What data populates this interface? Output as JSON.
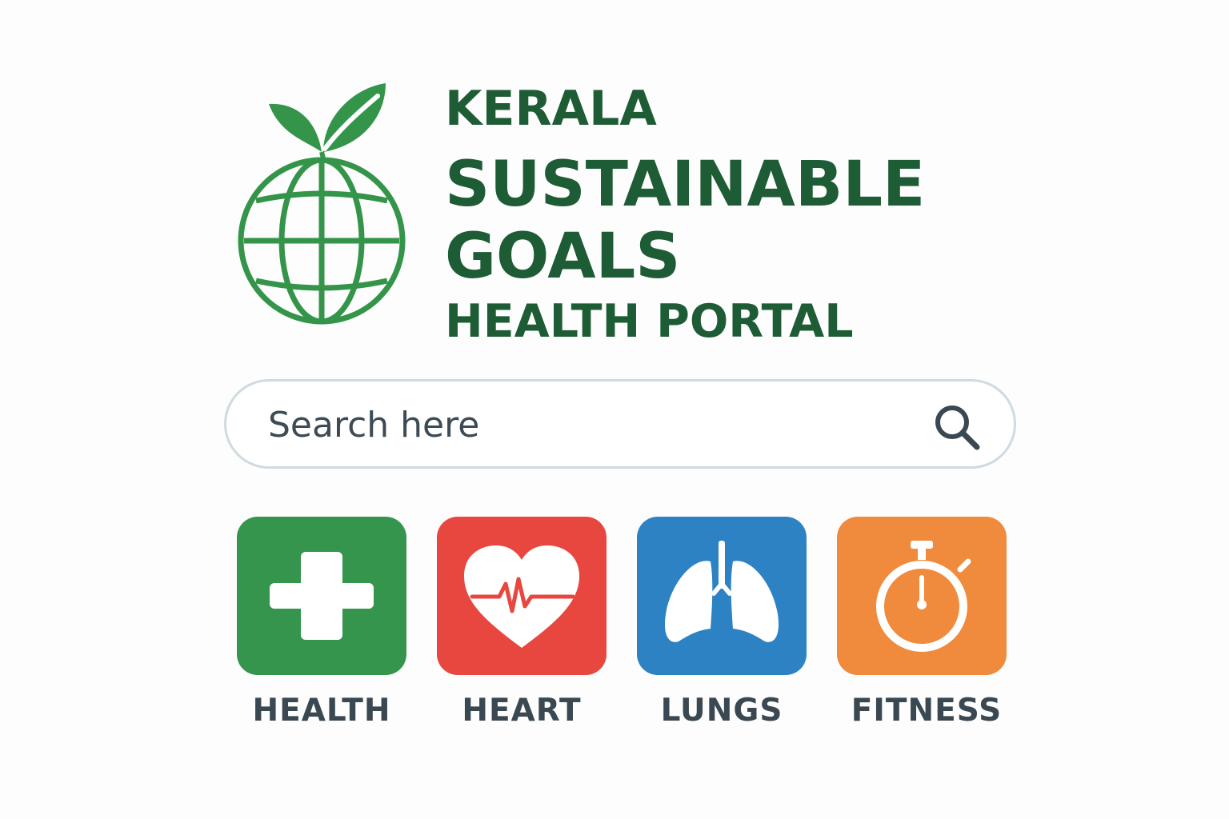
{
  "brand": {
    "title_line1": "KERALA",
    "title_line2": "SUSTAINABLE",
    "title_line3": "GOALS",
    "title_line4": "HEALTH PORTAL",
    "logo_icon": "globe-leaf-icon",
    "primary_color": "#2e8b47",
    "title_color": "#1d5c35"
  },
  "search": {
    "placeholder": "Search here",
    "value": "",
    "icon": "search-icon"
  },
  "categories": [
    {
      "label": "HEALTH",
      "icon": "medical-cross-icon",
      "color": "#35954d"
    },
    {
      "label": "HEART",
      "icon": "heart-pulse-icon",
      "color": "#e8473f"
    },
    {
      "label": "LUNGS",
      "icon": "lungs-icon",
      "color": "#2c82c2"
    },
    {
      "label": "FITNESS",
      "icon": "stopwatch-icon",
      "color": "#f08a3c"
    }
  ]
}
